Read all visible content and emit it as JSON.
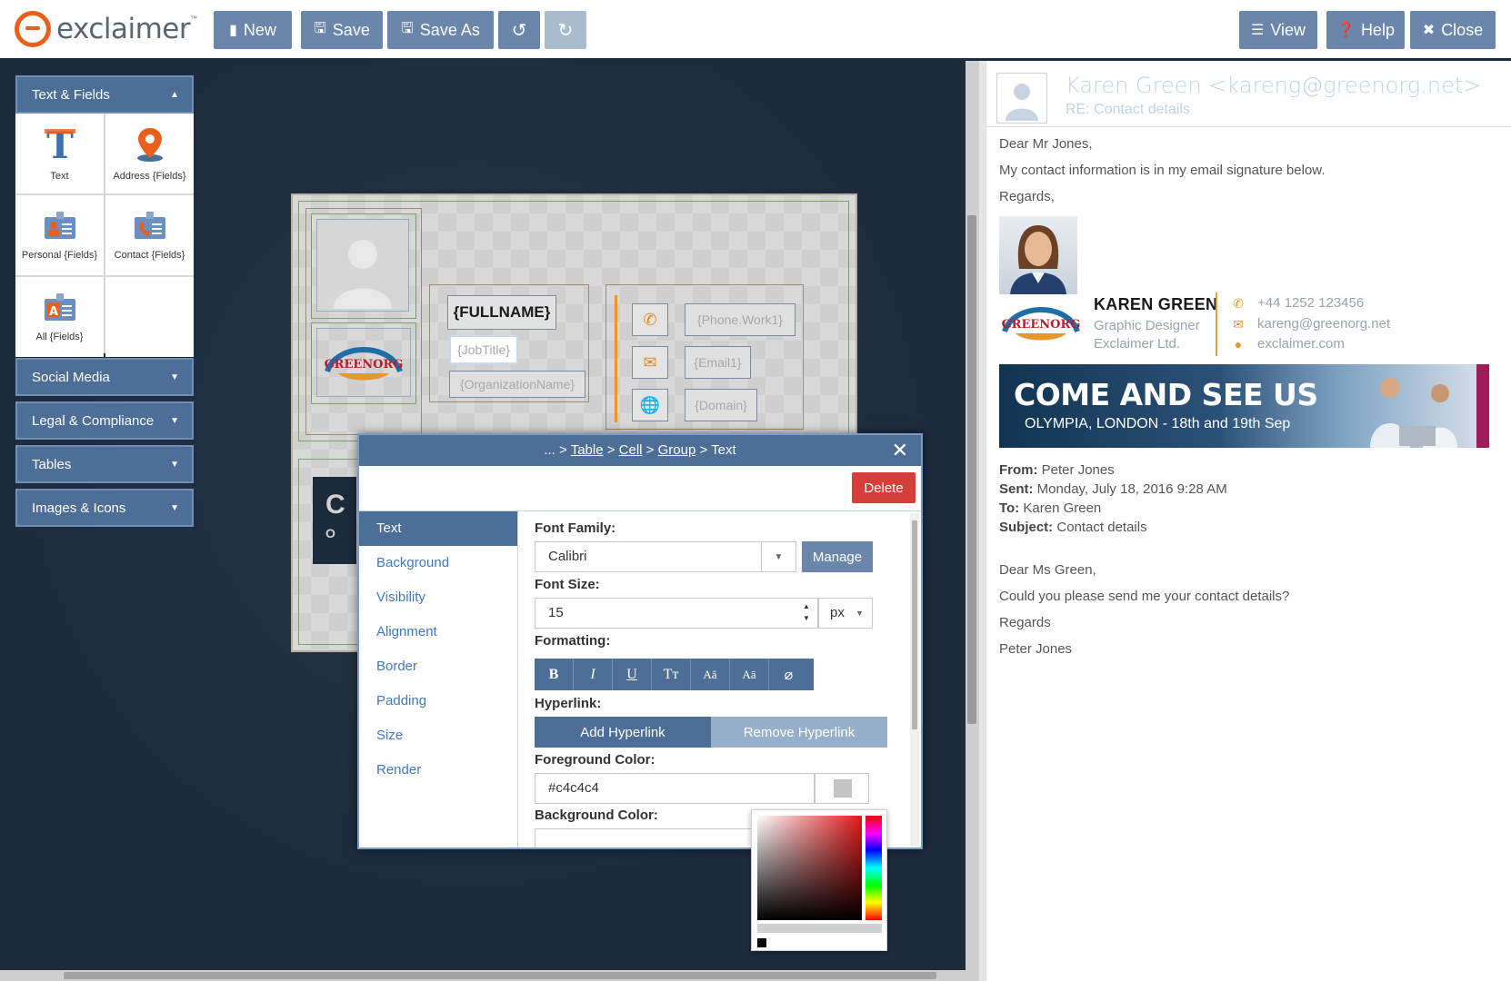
{
  "app": {
    "logo_text": "exclaimer",
    "logo_tm": "™"
  },
  "toolbar": {
    "new_label": "New",
    "save_label": "Save",
    "save_as_label": "Save As",
    "view_label": "View",
    "help_label": "Help",
    "close_label": "Close"
  },
  "sidebar": {
    "text_fields": {
      "title": "Text & Fields",
      "items": [
        {
          "label": "Text",
          "icon": "text-icon"
        },
        {
          "label": "Address {Fields}",
          "icon": "map-pin-icon"
        },
        {
          "label": "Personal {Fields}",
          "icon": "personal-card-icon"
        },
        {
          "label": "Contact {Fields}",
          "icon": "contact-card-icon"
        },
        {
          "label": "All {Fields}",
          "icon": "all-fields-icon"
        }
      ]
    },
    "social_media": "Social Media",
    "legal": "Legal & Compliance",
    "tables": "Tables",
    "images": "Images & Icons"
  },
  "template": {
    "fullname": "{FULLNAME}",
    "jobtitle": "{JobTitle}",
    "organization": "{OrganizationName}",
    "phone": "{Phone.Work1}",
    "email": "{Email1}",
    "domain": "{Domain}",
    "banner_fragment_1": "C",
    "banner_fragment_2": "O"
  },
  "dialog": {
    "breadcrumb_prefix": "... >",
    "breadcrumb": [
      "Table",
      "Cell",
      "Group"
    ],
    "current": "Text",
    "delete_label": "Delete",
    "nav": [
      "Text",
      "Background",
      "Visibility",
      "Alignment",
      "Border",
      "Padding",
      "Size",
      "Render"
    ],
    "font_family_label": "Font Family:",
    "font_family_value": "Calibri",
    "manage_label": "Manage",
    "font_size_label": "Font Size:",
    "font_size_value": "15",
    "font_size_unit": "px",
    "formatting_label": "Formatting:",
    "formatting_buttons": [
      "B",
      "I",
      "U",
      "Tт",
      "Aâ",
      "Aā",
      "⌀"
    ],
    "hyperlink_label": "Hyperlink:",
    "add_hyperlink": "Add Hyperlink",
    "remove_hyperlink": "Remove Hyperlink",
    "fg_label": "Foreground Color:",
    "fg_value": "#c4c4c4",
    "bg_label": "Background Color:"
  },
  "preview": {
    "from_header": "Karen Green <kareng@greenorg.net>",
    "subject_header": "RE: Contact details",
    "greeting": "Dear Mr Jones,",
    "body1": "My contact information is in my email signature below.",
    "regards": "Regards,",
    "sig_name": "KAREN GREEN",
    "sig_title": "Graphic Designer",
    "sig_company": "Exclaimer Ltd.",
    "sig_phone": "+44 1252 123456",
    "sig_email": "kareng@greenorg.net",
    "sig_web": "exclaimer.com",
    "banner_title": "COME AND SEE US",
    "banner_sub": "OLYMPIA, LONDON - 18th and 19th Sep",
    "from_label": "From:",
    "from_value": "Peter Jones",
    "sent_label": "Sent:",
    "sent_value": "Monday, July 18, 2016 9:28 AM",
    "to_label": "To:",
    "to_value": "Karen Green",
    "subject_label": "Subject:",
    "subject_value": "Contact details",
    "reply_greeting": "Dear Ms Green,",
    "reply_body": "Could you please send me your contact details?",
    "reply_regards": "Regards",
    "reply_sign": "Peter Jones"
  },
  "colors": {
    "accent": "#4d6e97",
    "button": "#6a86ab",
    "delete": "#d43f3a",
    "logo_orange": "#e8601c",
    "signature_orange": "#e8952c"
  }
}
